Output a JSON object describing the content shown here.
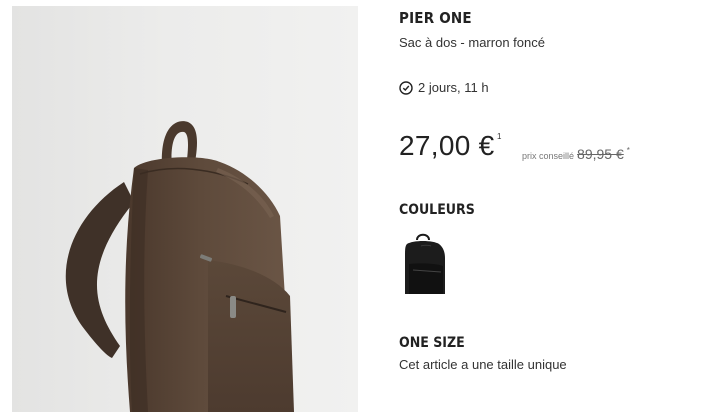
{
  "product": {
    "brand": "PIER ONE",
    "name": "Sac à dos - marron foncé",
    "image_icon": "brown-leather-backpack-photo"
  },
  "delivery": {
    "icon": "clock-icon",
    "text": "2 jours, 11 h"
  },
  "pricing": {
    "price": "27,00 €",
    "price_footnote": "1",
    "rrp_label": "prix conseillé",
    "rrp_value": "89,95 €",
    "rrp_footnote": "*"
  },
  "colors": {
    "title": "COULEURS",
    "options": [
      {
        "name": "black-backpack-swatch",
        "color": "#1a1a1a"
      }
    ]
  },
  "size": {
    "title": "ONE SIZE",
    "description": "Cet article a une taille unique"
  },
  "palette": {
    "bag_brown": "#5a4638",
    "photo_bg": "#ececeb"
  }
}
